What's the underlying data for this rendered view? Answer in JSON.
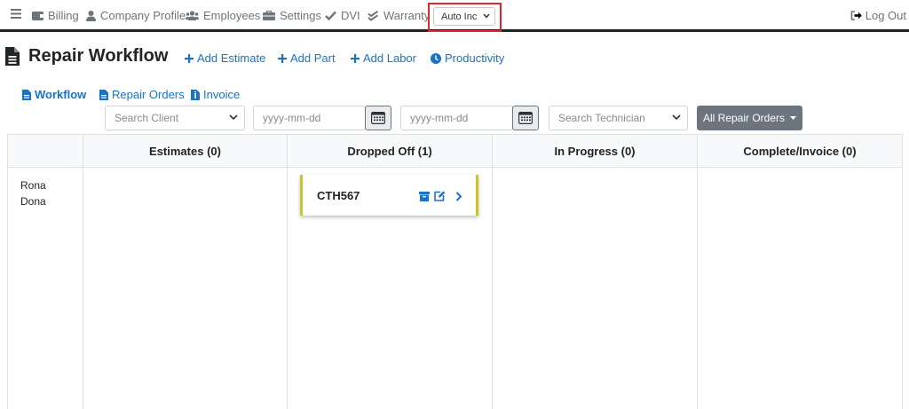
{
  "nav": {
    "billing": "Billing",
    "company_profile": "Company Profile",
    "employees": "Employees",
    "settings": "Settings",
    "dvi": "DVI",
    "warranty": "Warranty",
    "company_select": "Auto Inc",
    "logout": "Log Out"
  },
  "page": {
    "title": "Repair Workflow",
    "actions": {
      "add_estimate": "Add Estimate",
      "add_part": "Add Part",
      "add_labor": "Add Labor",
      "productivity": "Productivity"
    },
    "tabs": {
      "workflow": "Workflow",
      "repair_orders": "Repair Orders",
      "invoice": "Invoice"
    }
  },
  "filters": {
    "client_placeholder": "Search Client",
    "date_from_placeholder": "yyyy-mm-dd",
    "date_to_placeholder": "yyyy-mm-dd",
    "technician_placeholder": "Search Technician",
    "ro_filter": "All Repair Orders"
  },
  "board": {
    "columns": [
      "Estimates (0)",
      "Dropped Off (1)",
      "In Progress (0)",
      "Complete/Invoice (0)"
    ],
    "technician": "Rona Dona",
    "card": {
      "label": "CTH567",
      "accent_color": "#c9c62a"
    }
  },
  "colors": {
    "link": "#1a73c8",
    "highlight_box": "#e0262b",
    "button_gray": "#6c757d"
  }
}
